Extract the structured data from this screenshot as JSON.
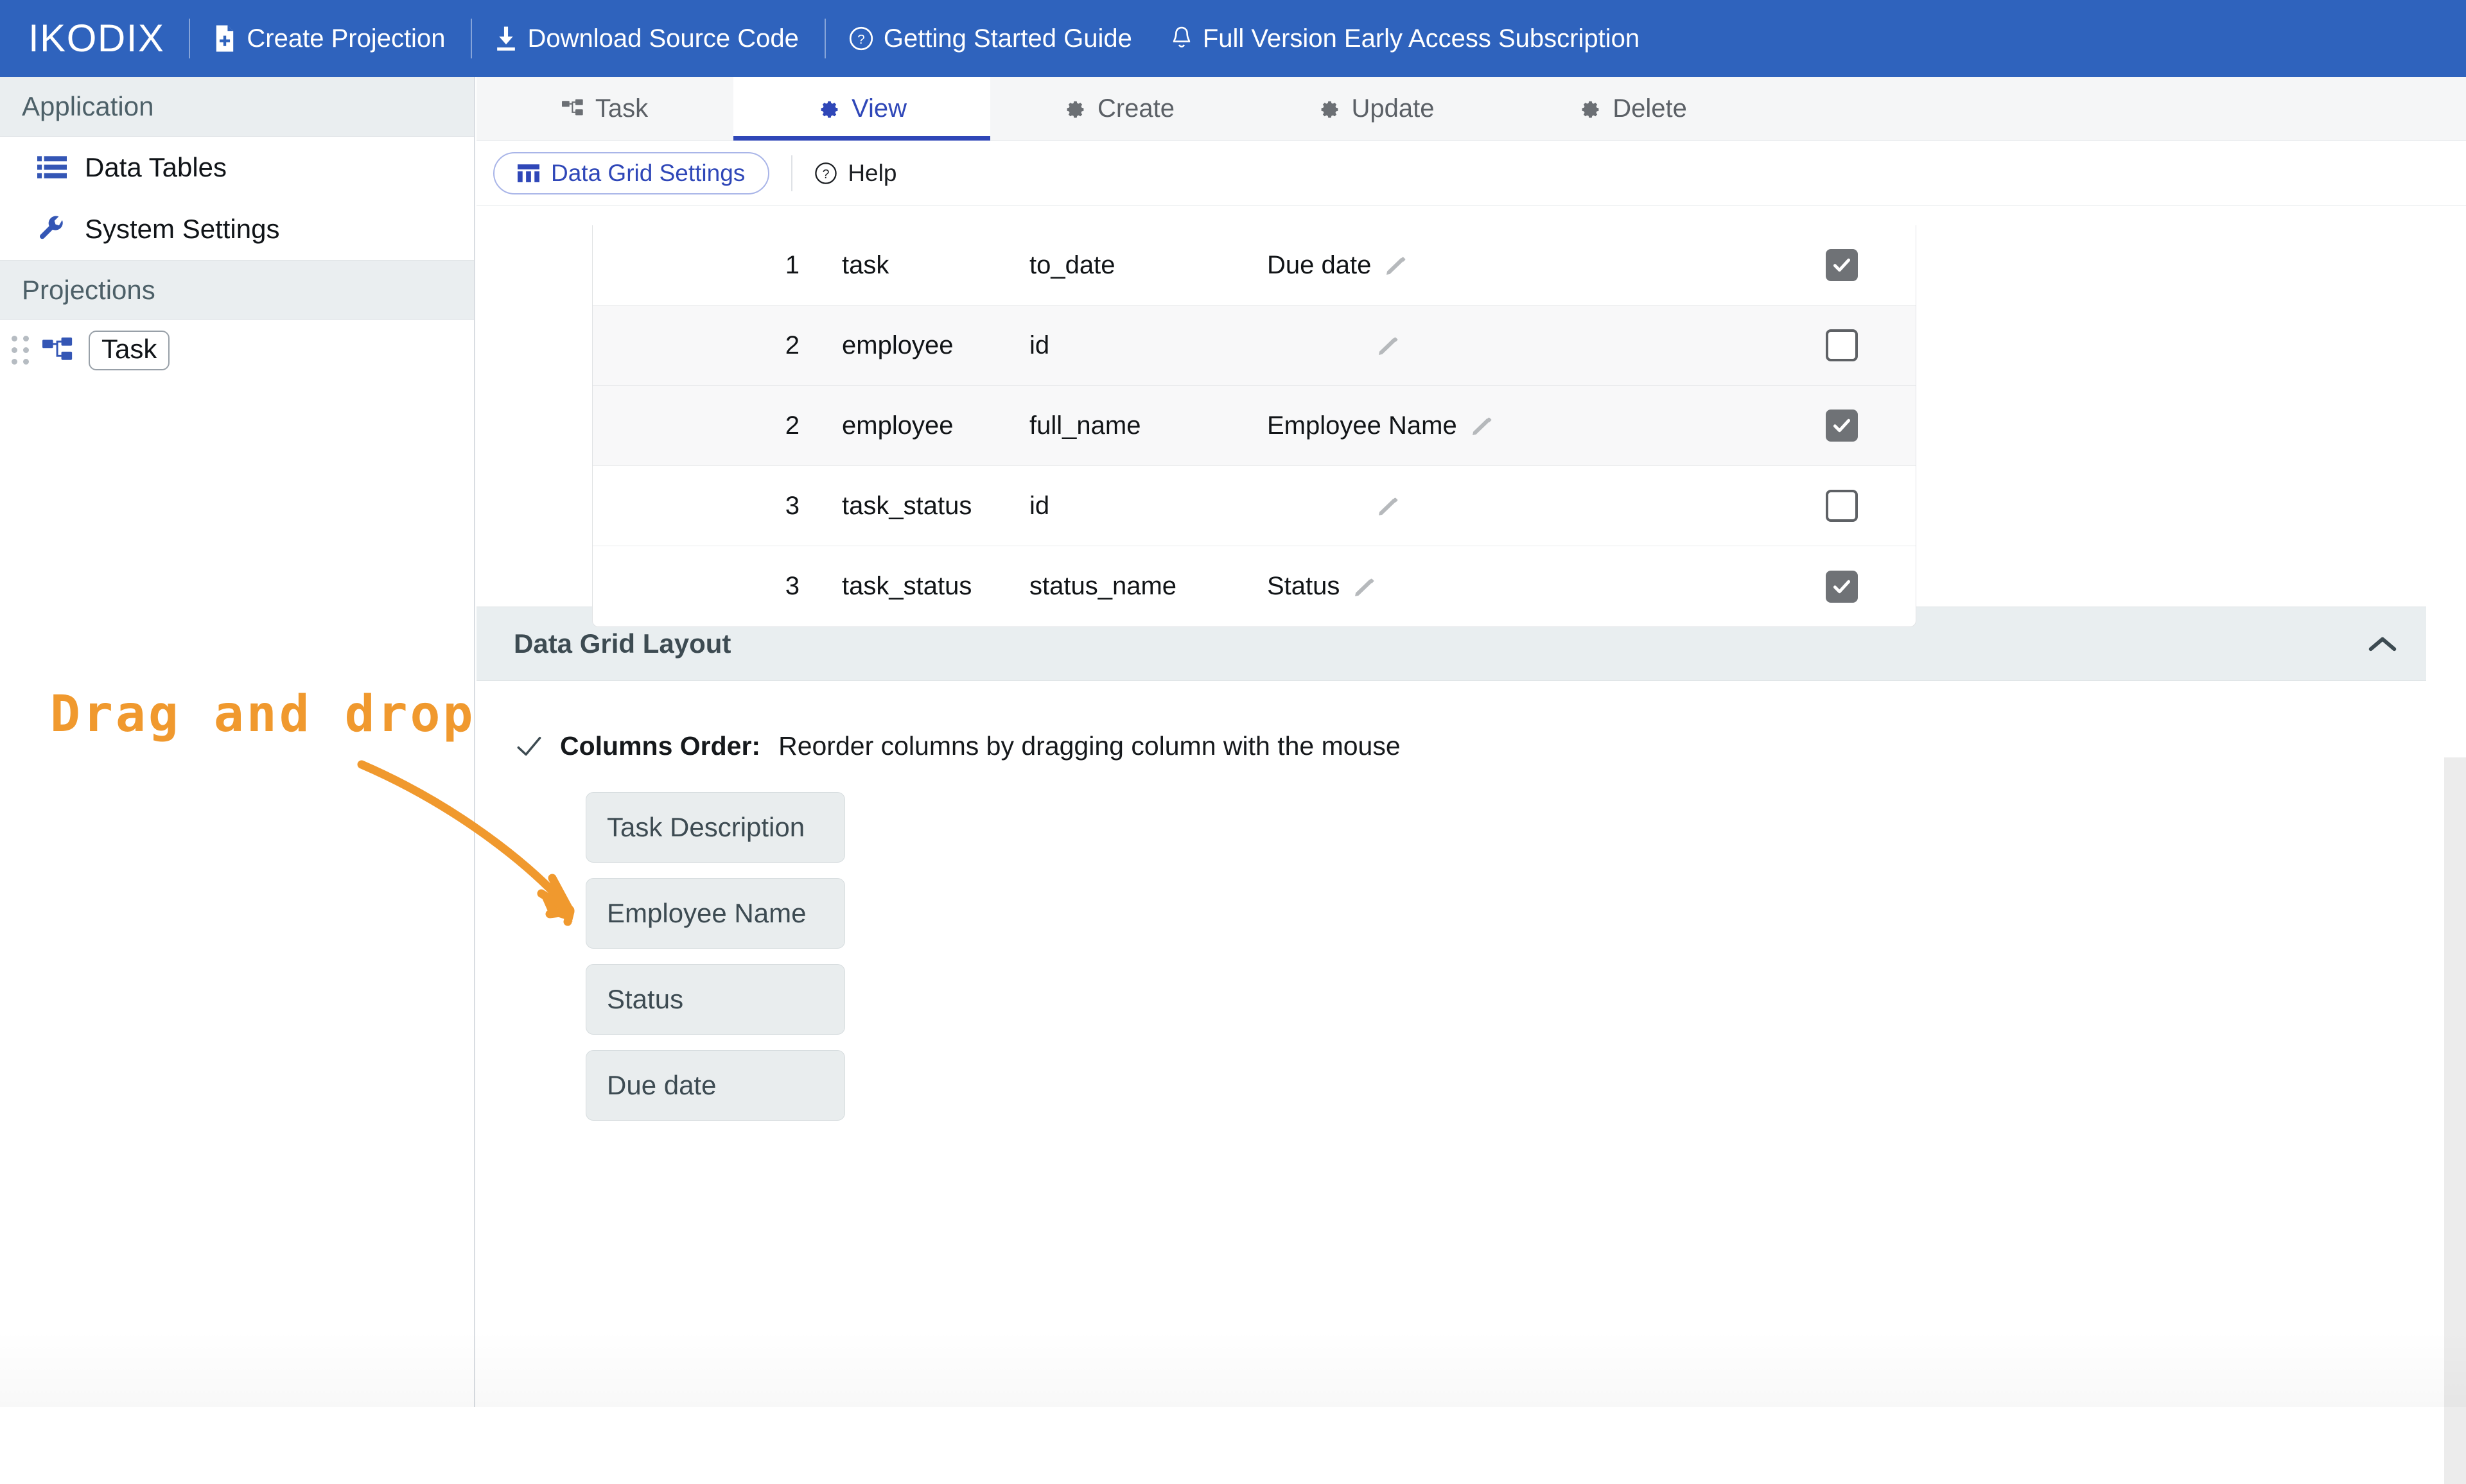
{
  "topbar": {
    "brand": "IKODIX",
    "items": [
      {
        "label": "Create Projection",
        "icon": "file-plus-icon"
      },
      {
        "label": "Download Source Code",
        "icon": "download-icon"
      },
      {
        "label": "Getting Started Guide",
        "icon": "question-circle-icon"
      },
      {
        "label": "Full Version Early Access Subscription",
        "icon": "bell-icon"
      }
    ],
    "background_color": "#2f63bd"
  },
  "sidebar": {
    "section_application": "Application",
    "items": [
      {
        "label": "Data Tables",
        "icon": "list-icon"
      },
      {
        "label": "System Settings",
        "icon": "wrench-icon"
      }
    ],
    "section_projections": "Projections",
    "projections": [
      {
        "label": "Task",
        "icon": "sitemap-icon",
        "handle": "drag-handle-icon"
      }
    ]
  },
  "tabs": [
    {
      "label": "Task",
      "icon": "sitemap-icon",
      "active": false
    },
    {
      "label": "View",
      "icon": "gear-icon",
      "active": true
    },
    {
      "label": "Create",
      "icon": "gear-icon",
      "active": false
    },
    {
      "label": "Update",
      "icon": "gear-icon",
      "active": false
    },
    {
      "label": "Delete",
      "icon": "gear-icon",
      "active": false
    }
  ],
  "subbar": {
    "settings_button": "Data Grid Settings",
    "help_label": "Help"
  },
  "table": {
    "rows": [
      {
        "num": "1",
        "table": "task",
        "field": "to_date",
        "alias": "Due date",
        "checked": true,
        "alt": false
      },
      {
        "num": "2",
        "table": "employee",
        "field": "id",
        "alias": "",
        "checked": false,
        "alt": true
      },
      {
        "num": "2",
        "table": "employee",
        "field": "full_name",
        "alias": "Employee Name",
        "checked": true,
        "alt": true
      },
      {
        "num": "3",
        "table": "task_status",
        "field": "id",
        "alias": "",
        "checked": false,
        "alt": false
      },
      {
        "num": "3",
        "table": "task_status",
        "field": "status_name",
        "alias": "Status",
        "checked": true,
        "alt": false
      }
    ]
  },
  "accordion": {
    "title": "Data Grid Layout",
    "collapse_icon": "chevron-up-icon",
    "columns_order_label": "Columns Order:",
    "columns_order_hint": "Reorder columns by dragging column with the mouse",
    "chips": [
      {
        "label": "Task Description"
      },
      {
        "label": "Employee Name"
      },
      {
        "label": "Status"
      },
      {
        "label": "Due date"
      }
    ]
  },
  "annotation": {
    "text": "Drag and drop",
    "color": "#f0992e",
    "arrow": "curved-arrow-icon"
  }
}
